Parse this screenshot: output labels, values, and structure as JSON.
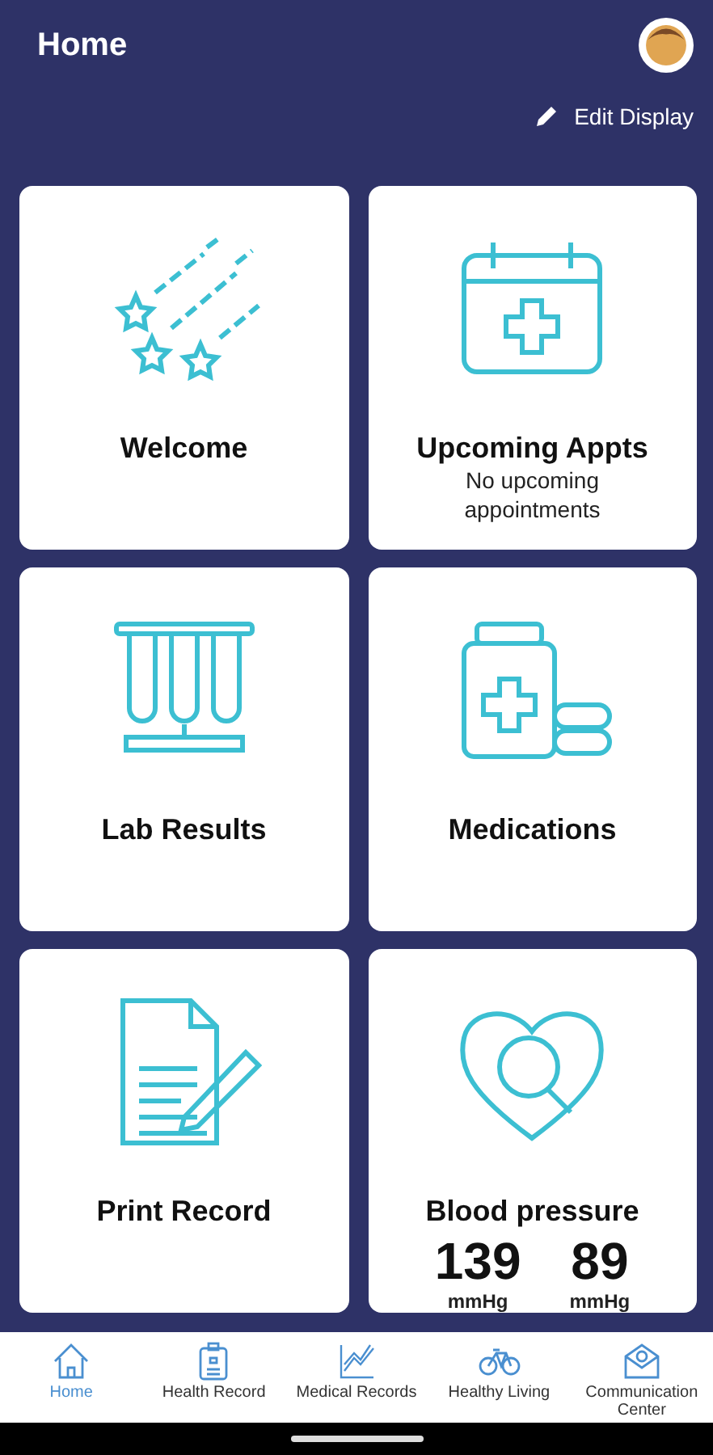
{
  "header": {
    "title": "Home",
    "edit_label": "Edit Display"
  },
  "tiles": [
    {
      "kind": "welcome",
      "title": "Welcome"
    },
    {
      "kind": "appointments",
      "title": "Upcoming Appts",
      "subtitle": "No upcoming appointments"
    },
    {
      "kind": "lab",
      "title": "Lab Results"
    },
    {
      "kind": "medications",
      "title": "Medications"
    },
    {
      "kind": "print",
      "title": "Print Record"
    },
    {
      "kind": "bp",
      "title": "Blood pressure",
      "readings": [
        {
          "value": "139",
          "unit": "mmHg"
        },
        {
          "value": "89",
          "unit": "mmHg"
        }
      ]
    }
  ],
  "bottom_nav": [
    {
      "kind": "home",
      "label": "Home",
      "selected": true
    },
    {
      "kind": "record",
      "label": "Health Record",
      "selected": false
    },
    {
      "kind": "chart",
      "label": "Medical Records",
      "selected": false
    },
    {
      "kind": "bike",
      "label": "Healthy Living",
      "selected": false
    },
    {
      "kind": "mail",
      "label": "Communication Center",
      "selected": false
    }
  ]
}
